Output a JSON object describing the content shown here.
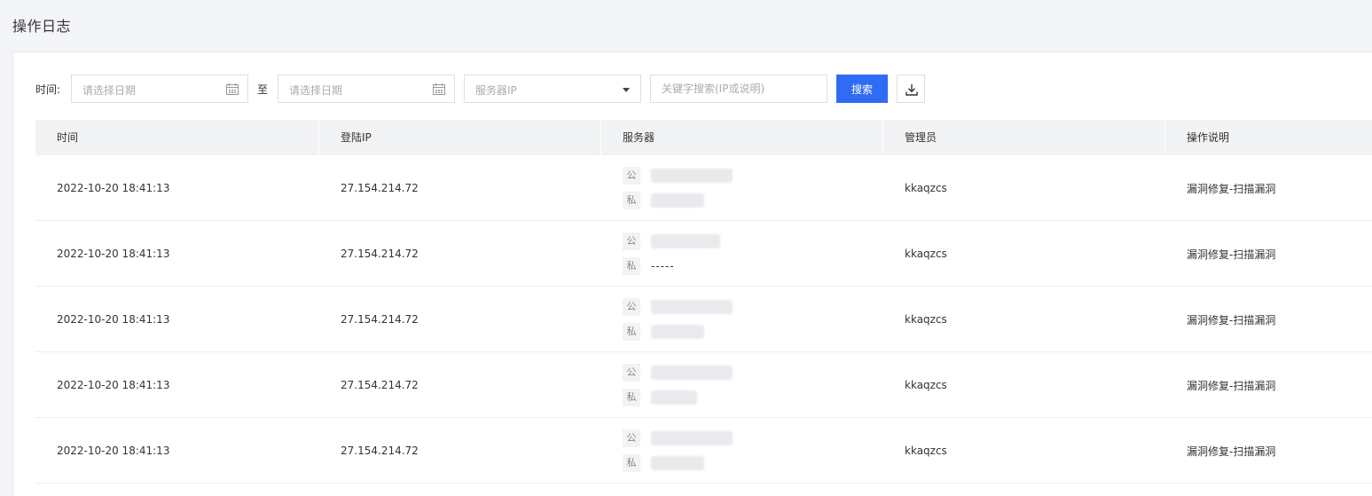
{
  "page": {
    "title": "操作日志"
  },
  "filters": {
    "time_label": "时间:",
    "start_date_placeholder": "请选择日期",
    "to_label": "至",
    "end_date_placeholder": "请选择日期",
    "server_ip_placeholder": "服务器IP",
    "keyword_placeholder": "关键字搜索(IP或说明)",
    "search_button": "搜索"
  },
  "table": {
    "headers": [
      "时间",
      "登陆IP",
      "服务器",
      "管理员",
      "操作说明"
    ],
    "public_tag": "公",
    "private_tag": "私",
    "rows": [
      {
        "time": "2022-10-20 18:41:13",
        "login_ip": "27.154.214.72",
        "private_ip_text": "",
        "admin": "kkaqzcs",
        "description": "漏洞修复-扫描漏洞"
      },
      {
        "time": "2022-10-20 18:41:13",
        "login_ip": "27.154.214.72",
        "private_ip_text": "-----",
        "admin": "kkaqzcs",
        "description": "漏洞修复-扫描漏洞"
      },
      {
        "time": "2022-10-20 18:41:13",
        "login_ip": "27.154.214.72",
        "private_ip_text": "",
        "admin": "kkaqzcs",
        "description": "漏洞修复-扫描漏洞"
      },
      {
        "time": "2022-10-20 18:41:13",
        "login_ip": "27.154.214.72",
        "private_ip_text": "",
        "admin": "kkaqzcs",
        "description": "漏洞修复-扫描漏洞"
      },
      {
        "time": "2022-10-20 18:41:13",
        "login_ip": "27.154.214.72",
        "private_ip_text": "",
        "admin": "kkaqzcs",
        "description": "漏洞修复-扫描漏洞"
      }
    ]
  },
  "colors": {
    "primary": "#2f6bf5",
    "header_bg": "#f2f3f5",
    "page_bg": "#f4f5f9"
  }
}
